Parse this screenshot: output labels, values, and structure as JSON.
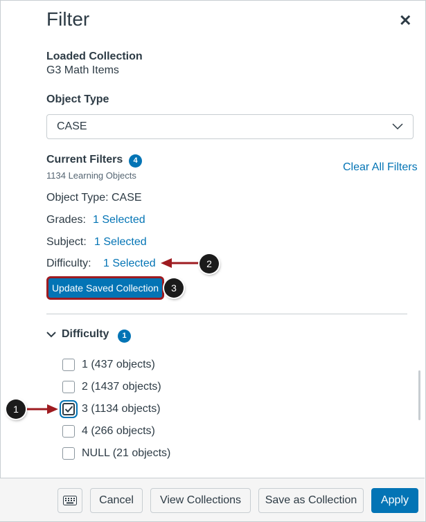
{
  "header": {
    "title": "Filter",
    "close_glyph": "✕"
  },
  "loaded_collection": {
    "label": "Loaded Collection",
    "value": "G3 Math Items"
  },
  "object_type": {
    "label": "Object Type",
    "selected": "CASE"
  },
  "current_filters": {
    "label": "Current Filters",
    "count": "4",
    "subtitle": "1134 Learning Objects",
    "clear_all": "Clear All Filters",
    "object_type_line": "Object Type: CASE",
    "grades_label": "Grades:",
    "grades_value": "1 Selected",
    "subject_label": "Subject:",
    "subject_value": "1 Selected",
    "difficulty_label": "Difficulty:",
    "difficulty_value": "1 Selected"
  },
  "update_button": "Update Saved Collection",
  "difficulty_section": {
    "title": "Difficulty",
    "count": "1",
    "options": [
      {
        "label": "1 (437 objects)",
        "checked": false
      },
      {
        "label": "2 (1437 objects)",
        "checked": false
      },
      {
        "label": "3 (1134 objects)",
        "checked": true
      },
      {
        "label": "4 (266 objects)",
        "checked": false
      },
      {
        "label": "NULL (21 objects)",
        "checked": false
      }
    ]
  },
  "callouts": [
    "1",
    "2",
    "3"
  ],
  "footer": {
    "keyboard_icon": "keyboard-icon",
    "cancel": "Cancel",
    "view_collections": "View Collections",
    "save_as_collection": "Save as Collection",
    "apply": "Apply"
  },
  "colors": {
    "link": "#0374b5",
    "annotation": "#9e1b20",
    "text": "#2d3b45"
  }
}
